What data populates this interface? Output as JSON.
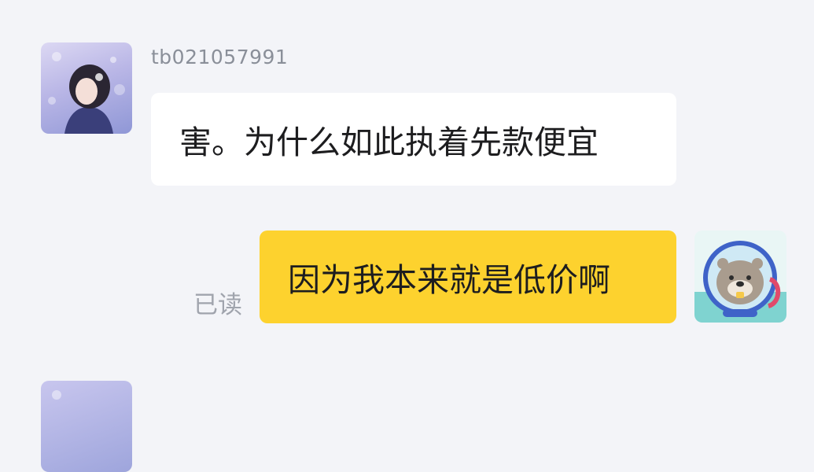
{
  "messages": [
    {
      "direction": "incoming",
      "username": "tb021057991",
      "text": "害。为什么如此执着先款便宜",
      "avatar_icon": "girl-portrait-avatar"
    },
    {
      "direction": "outgoing",
      "read_status": "已读",
      "text": "因为我本来就是低价啊",
      "avatar_icon": "otter-diver-avatar"
    }
  ],
  "colors": {
    "background": "#f3f4f8",
    "incoming_bubble": "#ffffff",
    "outgoing_bubble": "#fdd22e",
    "username_text": "#8a8f99",
    "read_status_text": "#a0a4ad",
    "message_text": "#1d1d1f"
  }
}
